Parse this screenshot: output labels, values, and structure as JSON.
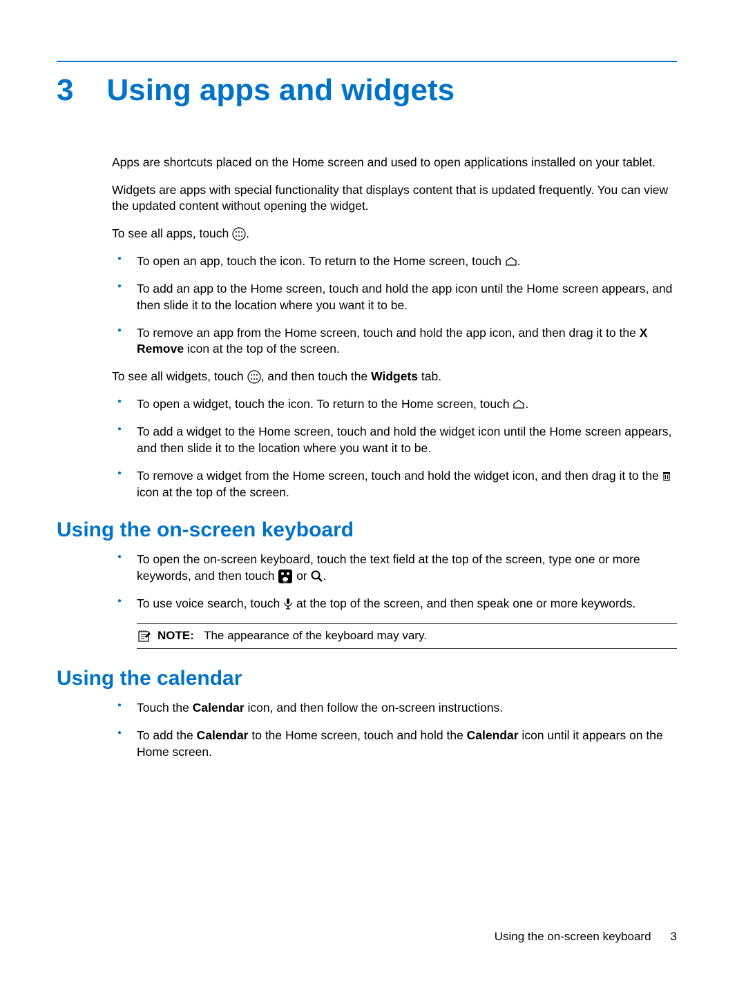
{
  "chapter": {
    "number": "3",
    "title": "Using apps and widgets"
  },
  "intro": {
    "p1": "Apps are shortcuts placed on the Home screen and used to open applications installed on your tablet.",
    "p2": "Widgets are apps with special functionality that displays content that is updated frequently. You can view the updated content without opening the widget.",
    "see_apps_pre": "To see all apps, touch ",
    "see_apps_post": "."
  },
  "apps_bullets": {
    "b1_pre": "To open an app, touch the icon. To return to the Home screen, touch ",
    "b1_post": ".",
    "b2": "To add an app to the Home screen, touch and hold the app icon until the Home screen appears, and then slide it to the location where you want it to be.",
    "b3_pre": "To remove an app from the Home screen, touch and hold the app icon, and then drag it to the ",
    "b3_bold": "X Remove",
    "b3_post": " icon at the top of the screen."
  },
  "widgets_intro": {
    "pre": "To see all widgets, touch ",
    "mid": ", and then touch the ",
    "bold": "Widgets",
    "post": " tab."
  },
  "widgets_bullets": {
    "b1_pre": "To open a widget, touch the icon. To return to the Home screen, touch ",
    "b1_post": ".",
    "b2": "To add a widget to the Home screen, touch and hold the widget icon until the Home screen appears, and then slide it to the location where you want it to be.",
    "b3_pre": "To remove a widget from the Home screen, touch and hold the widget icon, and then drag it to the ",
    "b3_post": " icon at the top of the screen."
  },
  "sections": {
    "keyboard": {
      "heading": "Using the on-screen keyboard",
      "b1_pre": "To open the on-screen keyboard, touch the text field at the top of the screen, type one or more keywords, and then touch ",
      "b1_mid": " or ",
      "b1_post": ".",
      "b2_pre": "To use voice search, touch ",
      "b2_post": " at the top of the screen, and then speak one or more keywords.",
      "note_label": "NOTE:",
      "note_text": "The appearance of the keyboard may vary."
    },
    "calendar": {
      "heading": "Using the calendar",
      "b1_pre": "Touch the ",
      "b1_bold": "Calendar",
      "b1_post": " icon, and then follow the on-screen instructions.",
      "b2_pre": "To add the ",
      "b2_bold1": "Calendar",
      "b2_mid": " to the Home screen, touch and hold the ",
      "b2_bold2": "Calendar",
      "b2_post": " icon until it appears on the Home screen."
    }
  },
  "footer": {
    "section": "Using the on-screen keyboard",
    "page": "3"
  }
}
